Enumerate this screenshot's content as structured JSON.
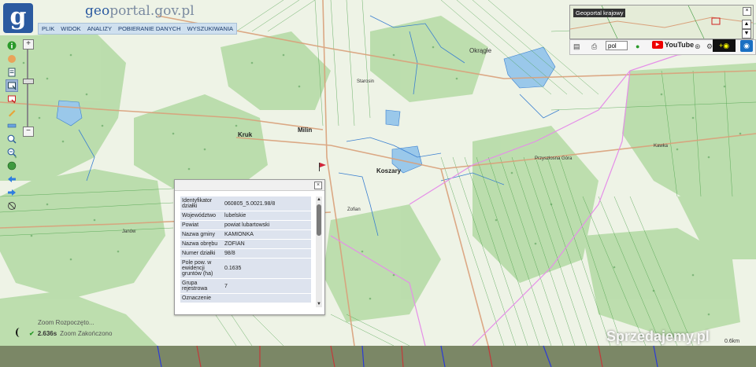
{
  "app": {
    "logo_letter": "g",
    "brand_prefix": "geo",
    "brand_suffix": "portal.gov.pl"
  },
  "menu": [
    "PLIK",
    "WIDOK",
    "ANALIZY",
    "POBIERANIE DANYCH",
    "WYSZUKIWANIA"
  ],
  "places": {
    "okragle": "Okrągłe",
    "starosin": "Starosin",
    "kruk": "Kruk",
    "milin": "Milin",
    "koszary": "Koszary",
    "zofian": "Zofian",
    "janow": "Janów",
    "kawka": "Kawka",
    "przyszlosna_gora": "Przyszłosna Góra"
  },
  "overview": {
    "title": "Geoportal krajowy"
  },
  "controls": {
    "language": "pol",
    "youtube_label": "YouTube"
  },
  "popup": {
    "rows": [
      {
        "key": "Identyfikator działki",
        "value": "060805_5.0021.98/8"
      },
      {
        "key": "Województwo",
        "value": "lubelskie"
      },
      {
        "key": "Powiat",
        "value": "powiat lubartowski"
      },
      {
        "key": "Nazwa gminy",
        "value": "KAMIONKA"
      },
      {
        "key": "Nazwa obrębu",
        "value": "ZOFIAN"
      },
      {
        "key": "Numer działki",
        "value": "98/8"
      },
      {
        "key": "Pole pow. w ewidencji gruntów (ha)",
        "value": "0.1635"
      },
      {
        "key": "Grupa rejestrowa",
        "value": "7"
      },
      {
        "key": "Oznaczenie",
        "value": ""
      }
    ]
  },
  "log": [
    {
      "time": "",
      "text": "Zoom  Rozpoczęto..."
    },
    {
      "time": "2.636s",
      "text": "Zoom  Zakończono"
    }
  ],
  "watermark": "Sprzedajemy.pl",
  "scale_label": "0.6km",
  "colors": {
    "map_bg": "#eef3e6",
    "forest": "#b9dcab",
    "water": "#9ac8ea",
    "road": "#d9a07a",
    "boundary": "#e58ee8",
    "parcel": "#3f9a3f"
  }
}
